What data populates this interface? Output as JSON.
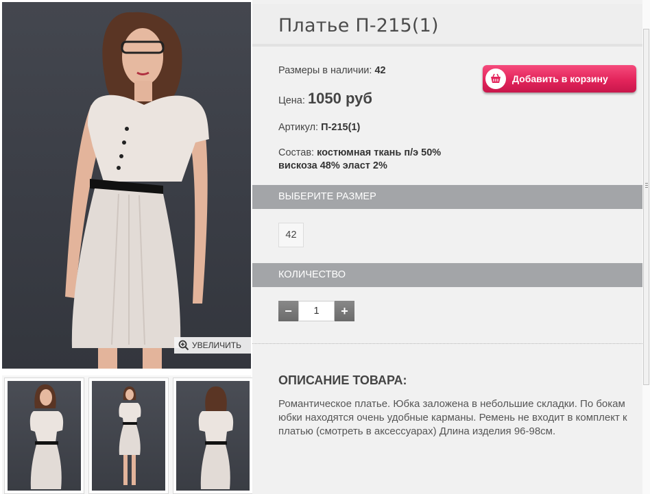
{
  "product": {
    "title": "Платье П-215(1)",
    "sizes_label": "Размеры в наличии:",
    "sizes_value": "42",
    "price_label": "Цена:",
    "price_value": "1050 руб",
    "article_label": "Артикул:",
    "article_value": "П-215(1)",
    "composition_label": "Состав:",
    "composition_value_line1": "костюмная ткань п/э 50%",
    "composition_value_line2": "вискоза 48% эласт 2%"
  },
  "cart_button": {
    "label": "Добавить в корзину",
    "icon": "basket-icon"
  },
  "gallery": {
    "zoom_label": "УВЕЛИЧИТЬ",
    "zoom_icon": "zoom-in-icon"
  },
  "size_section": {
    "header": "ВЫБЕРИТЕ РАЗМЕР",
    "options": [
      "42"
    ]
  },
  "quantity_section": {
    "header": "КОЛИЧЕСТВО",
    "minus": "−",
    "value": "1",
    "plus": "+"
  },
  "description": {
    "heading": "ОПИСАНИЕ ТОВАРА:",
    "text": "Романтическое платье. Юбка заложена в небольшие складки. По бокам юбки находятся очень удобные карманы. Ремень не входит в комплект к платью (смотреть в аксессуарах) Длина изделия 96-98см."
  },
  "colors": {
    "accent_pink": "#e3245b",
    "section_gray": "#a3a5a8",
    "panel_bg": "#f1f1f1"
  }
}
